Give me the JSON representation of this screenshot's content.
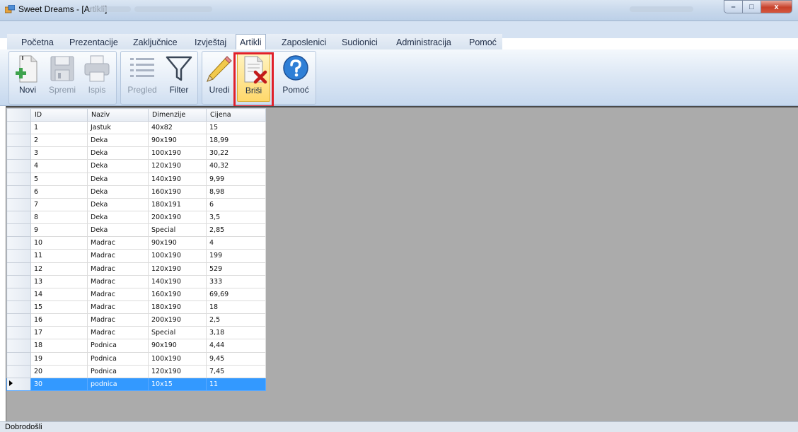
{
  "window": {
    "title": "Sweet Dreams - [Artikli]",
    "controls": {
      "minimize": "–",
      "maximize": "□",
      "close": "x"
    }
  },
  "menu": {
    "items": [
      "Početna",
      "Prezentacije",
      "Zaključnice",
      "Izvještaj",
      "Artikli",
      "Zaposlenici",
      "Sudionici",
      "Administracija",
      "Pomoć"
    ],
    "active": "Artikli"
  },
  "toolbar": {
    "novi": "Novi",
    "spremi": "Spremi",
    "ispis": "Ispis",
    "pregled": "Pregled",
    "filter": "Filter",
    "uredi": "Uredi",
    "brisi": "Briši",
    "pomoc": "Pomoć",
    "selected": "Briši",
    "disabled": [
      "Spremi",
      "Ispis",
      "Pregled"
    ]
  },
  "grid": {
    "columns": [
      "ID",
      "Naziv",
      "Dimenzije",
      "Cijena"
    ],
    "rows": [
      [
        "1",
        "Jastuk",
        "40x82",
        "15"
      ],
      [
        "2",
        "Deka",
        "90x190",
        "18,99"
      ],
      [
        "3",
        "Deka",
        "100x190",
        "30,22"
      ],
      [
        "4",
        "Deka",
        "120x190",
        "40,32"
      ],
      [
        "5",
        "Deka",
        "140x190",
        "9,99"
      ],
      [
        "6",
        "Deka",
        "160x190",
        "8,98"
      ],
      [
        "7",
        "Deka",
        "180x191",
        "6"
      ],
      [
        "8",
        "Deka",
        "200x190",
        "3,5"
      ],
      [
        "9",
        "Deka",
        "Special",
        "2,85"
      ],
      [
        "10",
        "Madrac",
        "90x190",
        "4"
      ],
      [
        "11",
        "Madrac",
        "100x190",
        "199"
      ],
      [
        "12",
        "Madrac",
        "120x190",
        "529"
      ],
      [
        "13",
        "Madrac",
        "140x190",
        "333"
      ],
      [
        "14",
        "Madrac",
        "160x190",
        "69,69"
      ],
      [
        "15",
        "Madrac",
        "180x190",
        "18"
      ],
      [
        "16",
        "Madrac",
        "200x190",
        "2,5"
      ],
      [
        "17",
        "Madrac",
        "Special",
        "3,18"
      ],
      [
        "18",
        "Podnica",
        "90x190",
        "4,44"
      ],
      [
        "19",
        "Podnica",
        "100x190",
        "9,45"
      ],
      [
        "20",
        "Podnica",
        "120x190",
        "7,45"
      ],
      [
        "30",
        "podnica",
        "10x15",
        "11"
      ]
    ],
    "selected_row_index": 20
  },
  "status": {
    "text": "Dobrodošli"
  },
  "colors": {
    "selection": "#3399ff",
    "highlight_box": "#e0202a",
    "grid_background": "#ababab"
  },
  "icons": {
    "novi": "new-document-icon",
    "spremi": "save-disk-icon",
    "ispis": "printer-icon",
    "pregled": "list-icon",
    "filter": "funnel-icon",
    "uredi": "pencil-icon",
    "brisi": "delete-document-icon",
    "pomoc": "help-question-icon"
  }
}
